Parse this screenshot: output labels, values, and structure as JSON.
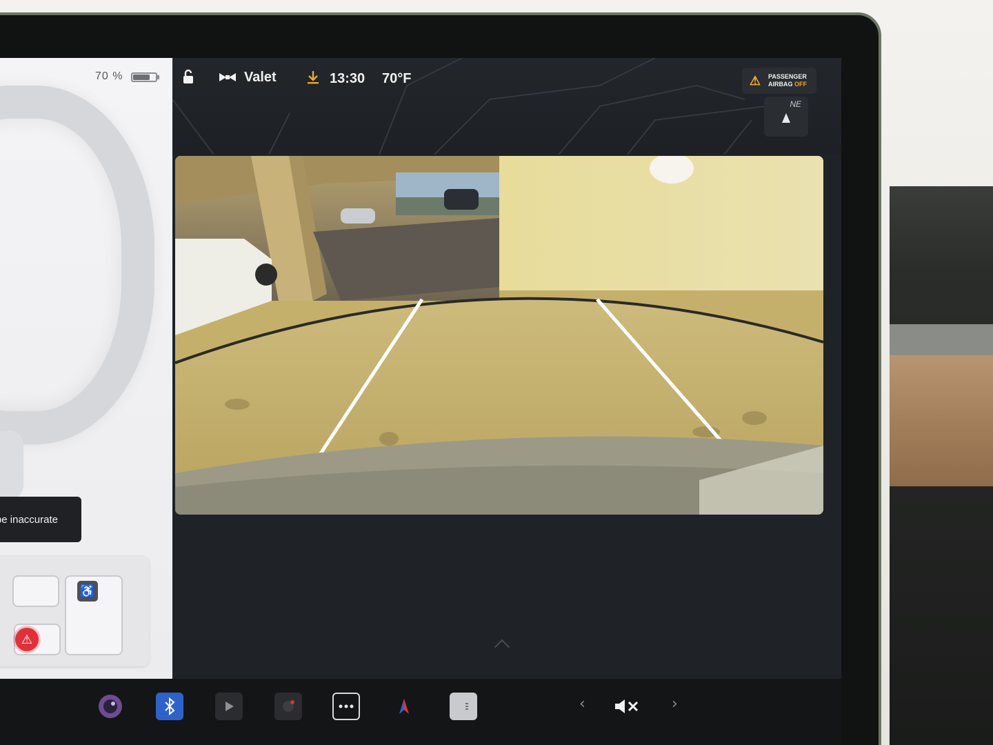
{
  "status_bar": {
    "drive_mode_label": "Valet",
    "time": "13:30",
    "temperature": "70°F",
    "airbag_line1": "PASSENGER",
    "airbag_line2_prefix": "AIRBAG",
    "airbag_line2_status": "OFF",
    "compass_heading": "NE"
  },
  "left_panel": {
    "battery_percent": "70 %",
    "battery_level": 0.7,
    "toast_text": "ay be inaccurate"
  },
  "camera": {
    "view": "rear-camera"
  },
  "dock": {
    "left_arrow": "›",
    "items": [
      "camera-app-icon",
      "bluetooth-icon",
      "media-player-icon",
      "dashcam-icon",
      "more-apps-icon",
      "navigation-icon",
      "climate-icon"
    ],
    "prev_glyph": "‹",
    "next_glyph": "›",
    "mute_glyph": "✕"
  },
  "colors": {
    "warning_red": "#e0313a",
    "airbag_amber": "#f2b02d",
    "bluetooth_blue": "#2f62c9"
  }
}
